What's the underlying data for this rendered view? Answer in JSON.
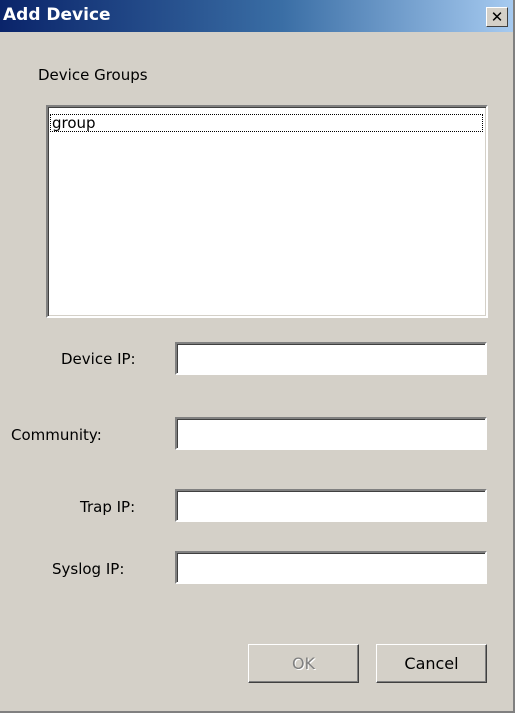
{
  "window": {
    "title": "Add Device",
    "close_glyph": "✕",
    "close_icon": "close-icon"
  },
  "device_groups": {
    "label": "Device Groups",
    "items": [
      "group"
    ]
  },
  "fields": {
    "device_ip": {
      "label": "Device IP:",
      "value": ""
    },
    "community": {
      "label": "Community:",
      "value": ""
    },
    "trap_ip": {
      "label": "Trap IP:",
      "value": ""
    },
    "syslog_ip": {
      "label": "Syslog IP:",
      "value": ""
    }
  },
  "buttons": {
    "ok": {
      "label": "OK",
      "enabled": false
    },
    "cancel": {
      "label": "Cancel",
      "enabled": true
    }
  }
}
